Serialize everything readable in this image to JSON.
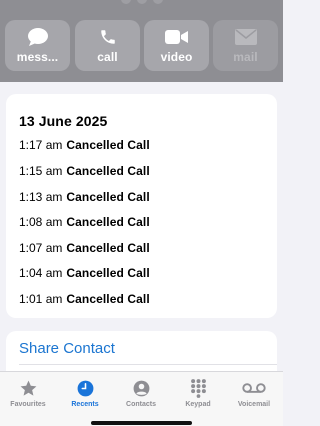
{
  "actions": [
    {
      "label": "mess...",
      "icon": "message-icon",
      "enabled": true
    },
    {
      "label": "call",
      "icon": "phone-icon",
      "enabled": true
    },
    {
      "label": "video",
      "icon": "video-icon",
      "enabled": true
    },
    {
      "label": "mail",
      "icon": "mail-icon",
      "enabled": false
    }
  ],
  "call_history": {
    "date": "13 June 2025",
    "calls": [
      {
        "time": "1:17 am",
        "status": "Cancelled Call"
      },
      {
        "time": "1:15 am",
        "status": "Cancelled Call"
      },
      {
        "time": "1:13 am",
        "status": "Cancelled Call"
      },
      {
        "time": "1:08 am",
        "status": "Cancelled Call"
      },
      {
        "time": "1:07 am",
        "status": "Cancelled Call"
      },
      {
        "time": "1:04 am",
        "status": "Cancelled Call"
      },
      {
        "time": "1:01 am",
        "status": "Cancelled Call"
      }
    ]
  },
  "share_contact": "Share Contact",
  "tabbar": {
    "items": [
      {
        "label": "Favourites",
        "icon": "star-icon",
        "active": false
      },
      {
        "label": "Recents",
        "icon": "clock-icon",
        "active": true
      },
      {
        "label": "Contacts",
        "icon": "person-circle-icon",
        "active": false
      },
      {
        "label": "Keypad",
        "icon": "keypad-icon",
        "active": false
      },
      {
        "label": "Voicemail",
        "icon": "voicemail-icon",
        "active": false
      }
    ]
  },
  "colors": {
    "accent": "#1a74d9",
    "header_bg": "#8e8e93",
    "page_bg": "#f2f2f7"
  }
}
